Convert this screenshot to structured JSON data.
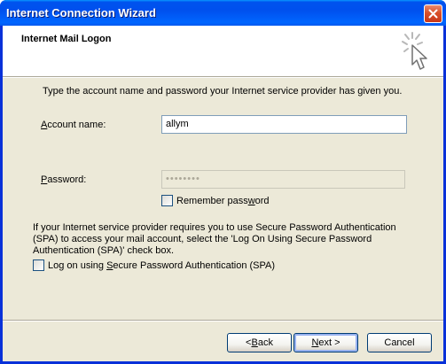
{
  "window": {
    "title": "Internet Connection Wizard"
  },
  "header": {
    "title": "Internet Mail Logon",
    "icon": "wizard-wand-icon"
  },
  "intro": "Type the account name and password your Internet service provider has given you.",
  "account": {
    "label_prefix": "",
    "label_key": "A",
    "label_rest": "ccount name:",
    "value": "allym"
  },
  "password": {
    "label_key": "P",
    "label_rest": "assword:",
    "value": "••••••••",
    "disabled": true
  },
  "remember": {
    "label_pre": "Remember pass",
    "label_key": "w",
    "label_rest": "ord",
    "checked": false
  },
  "spa_info": "If your Internet service provider requires you to use Secure Password Authentication (SPA) to access your mail account, select the 'Log On Using Secure Password Authentication (SPA)' check box.",
  "spa": {
    "label_pre": "Log on using ",
    "label_key": "S",
    "label_rest": "ecure Password Authentication (SPA)",
    "checked": false
  },
  "buttons": {
    "back_pre": "< ",
    "back_key": "B",
    "back_rest": "ack",
    "next_key": "N",
    "next_rest": "ext >",
    "cancel": "Cancel"
  },
  "colors": {
    "titlebar": "#0054e3",
    "dialog_bg": "#ece9d8",
    "close_button": "#d9502a"
  }
}
